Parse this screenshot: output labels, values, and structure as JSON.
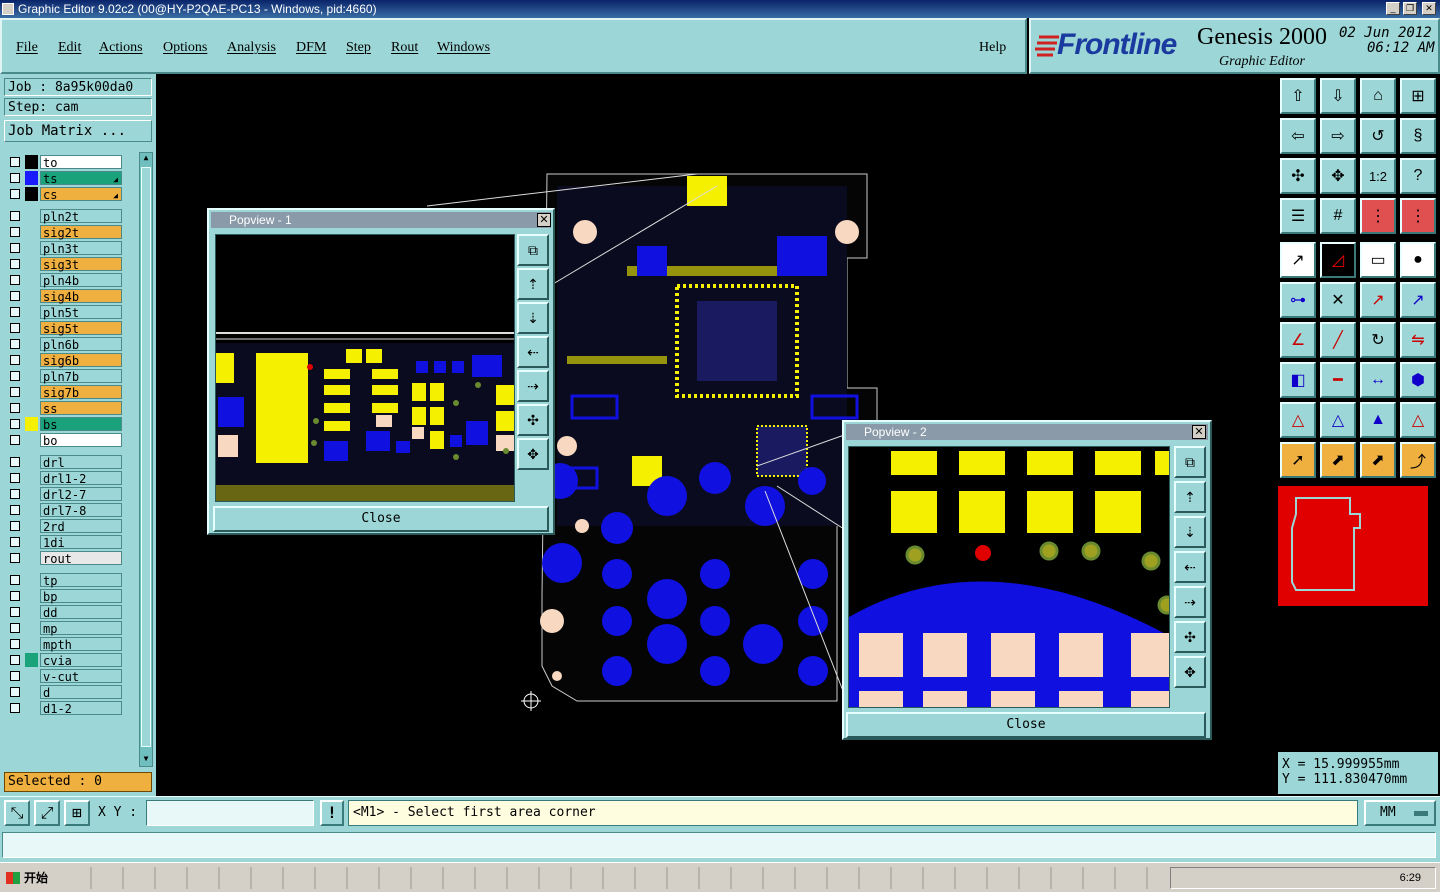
{
  "window": {
    "title": "Graphic Editor 9.02c2 (00@HY-P2QAE-PC13 - Windows, pid:4660)",
    "min": "_",
    "max": "❐",
    "close": "✕"
  },
  "menu": {
    "items": [
      "File",
      "Edit",
      "Actions",
      "Options",
      "Analysis",
      "DFM",
      "Step",
      "Rout",
      "Windows"
    ],
    "help": "Help"
  },
  "brand": {
    "logo": "Frontline",
    "product": "Genesis 2000",
    "subtitle": "Graphic Editor",
    "date": "02 Jun 2012",
    "time": "06:12 AM"
  },
  "job": {
    "job_label": "Job : 8a95k00da0",
    "step_label": "Step: cam",
    "matrix_button": "Job Matrix ..."
  },
  "layers": [
    {
      "name": "to",
      "color": "#000000",
      "bg": "#ffffff",
      "sel": false
    },
    {
      "name": "ts",
      "color": "#1a1aff",
      "bg": "#1aa37a",
      "sel": true,
      "arrow": true
    },
    {
      "name": "cs",
      "color": "#000000",
      "bg": "#f0b040",
      "sel": false,
      "arrow": true
    },
    {
      "name": "pln2t",
      "color": "",
      "bg": "#9cd6d6"
    },
    {
      "name": "sig2t",
      "color": "",
      "bg": "#f0b040"
    },
    {
      "name": "pln3t",
      "color": "",
      "bg": "#9cd6d6"
    },
    {
      "name": "sig3t",
      "color": "",
      "bg": "#f0b040"
    },
    {
      "name": "pln4b",
      "color": "",
      "bg": "#9cd6d6"
    },
    {
      "name": "sig4b",
      "color": "",
      "bg": "#f0b040"
    },
    {
      "name": "pln5t",
      "color": "",
      "bg": "#9cd6d6"
    },
    {
      "name": "sig5t",
      "color": "",
      "bg": "#f0b040"
    },
    {
      "name": "pln6b",
      "color": "",
      "bg": "#9cd6d6"
    },
    {
      "name": "sig6b",
      "color": "",
      "bg": "#f0b040"
    },
    {
      "name": "pln7b",
      "color": "",
      "bg": "#9cd6d6"
    },
    {
      "name": "sig7b",
      "color": "",
      "bg": "#f0b040"
    },
    {
      "name": "ss",
      "color": "",
      "bg": "#f0b040"
    },
    {
      "name": "bs",
      "color": "#f4f000",
      "bg": "#1aa37a"
    },
    {
      "name": "bo",
      "color": "",
      "bg": "#ffffff"
    },
    {
      "name": "drl",
      "color": "",
      "bg": "#9cd6d6"
    },
    {
      "name": "drl1-2",
      "color": "",
      "bg": "#9cd6d6"
    },
    {
      "name": "drl2-7",
      "color": "",
      "bg": "#9cd6d6"
    },
    {
      "name": "drl7-8",
      "color": "",
      "bg": "#9cd6d6"
    },
    {
      "name": "2rd",
      "color": "",
      "bg": "#9cd6d6"
    },
    {
      "name": "1di",
      "color": "",
      "bg": "#9cd6d6"
    },
    {
      "name": "rout",
      "color": "",
      "bg": "#e8e8e8"
    },
    {
      "name": "tp",
      "color": "",
      "bg": "#9cd6d6"
    },
    {
      "name": "bp",
      "color": "",
      "bg": "#9cd6d6"
    },
    {
      "name": "dd",
      "color": "",
      "bg": "#9cd6d6"
    },
    {
      "name": "mp",
      "color": "",
      "bg": "#9cd6d6"
    },
    {
      "name": "mpth",
      "color": "",
      "bg": "#9cd6d6"
    },
    {
      "name": "cvia",
      "color": "#1aa37a",
      "bg": "#9cd6d6"
    },
    {
      "name": "v-cut",
      "color": "",
      "bg": "#9cd6d6"
    },
    {
      "name": "d",
      "color": "",
      "bg": "#9cd6d6"
    },
    {
      "name": "d1-2",
      "color": "",
      "bg": "#9cd6d6"
    }
  ],
  "selected_label": "Selected : 0",
  "popup1": {
    "title": "Popview - 1",
    "close": "Close"
  },
  "popup2": {
    "title": "Popview - 2",
    "close": "Close"
  },
  "coords": {
    "x": "X = 15.999955mm",
    "y": "Y = 111.830470mm"
  },
  "bottom": {
    "xy_label": "X Y :",
    "xy_value": "",
    "prompt": "<M1> - Select first area corner",
    "units": "MM",
    "warn": "!"
  },
  "taskbar": {
    "start": "开始",
    "clock": "6:29"
  }
}
